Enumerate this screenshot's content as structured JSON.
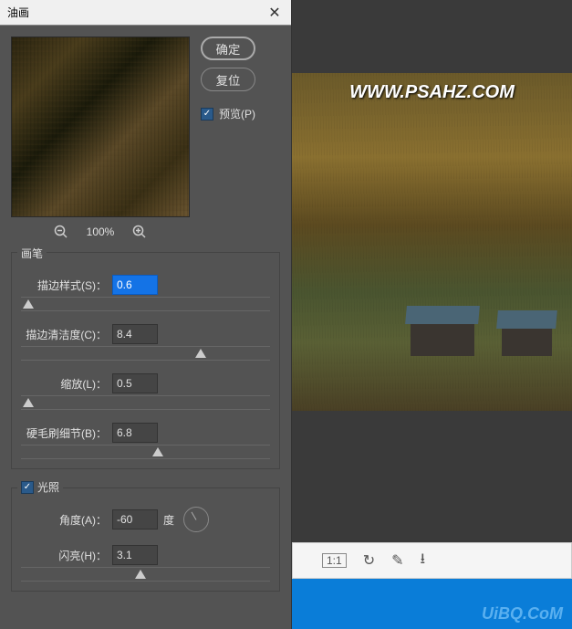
{
  "dialog": {
    "title": "油画",
    "ok_label": "确定",
    "reset_label": "复位",
    "preview_label": "预览(P)",
    "zoom_level": "100%"
  },
  "brush": {
    "section_label": "画笔",
    "stylization_label": "描边样式(S)：",
    "stylization_value": "0.6",
    "cleanliness_label": "描边清洁度(C)：",
    "cleanliness_value": "8.4",
    "scale_label": "缩放(L)：",
    "scale_value": "0.5",
    "bristle_label": "硬毛刷细节(B)：",
    "bristle_value": "6.8"
  },
  "lighting": {
    "section_label": "光照",
    "angle_label": "角度(A)：",
    "angle_value": "-60",
    "angle_unit": "度",
    "shine_label": "闪亮(H)：",
    "shine_value": "3.1"
  },
  "canvas": {
    "watermark": "WWW.PSAHZ.COM",
    "logo": "UiBQ.CoM"
  },
  "toolbar": {
    "icons": [
      "zoom-out-icon",
      "actual-pixels-icon",
      "redo-icon",
      "brush-icon",
      "download-icon"
    ]
  },
  "sliders": {
    "stylization_pos": "3%",
    "cleanliness_pos": "72%",
    "scale_pos": "3%",
    "bristle_pos": "55%",
    "shine_pos": "48%"
  }
}
